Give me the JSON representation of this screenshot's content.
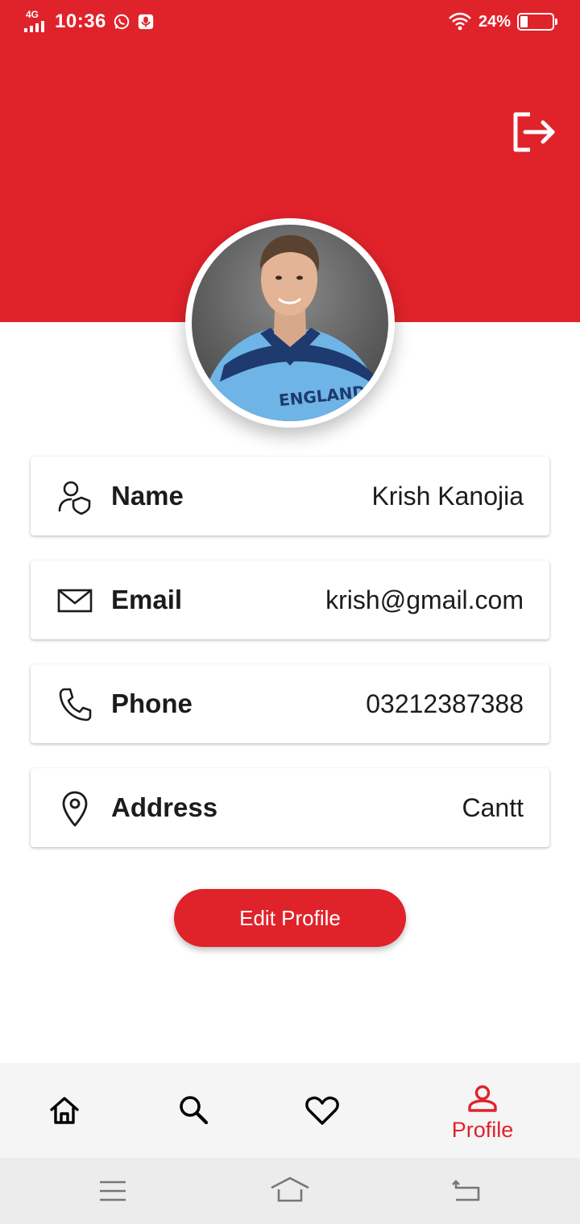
{
  "status_bar": {
    "network": "4G",
    "time": "10:36",
    "battery_percent": "24%",
    "battery_level": 0.24,
    "icons": [
      "signal-icon",
      "whatsapp-icon",
      "recorder-icon",
      "wifi-icon",
      "battery-icon"
    ]
  },
  "header": {
    "color": "#e0222b",
    "logout_icon": "logout-icon"
  },
  "profile": {
    "avatar_alt": "profile photo"
  },
  "fields": [
    {
      "icon": "user-shield-icon",
      "label": "Name",
      "value": "Krish Kanojia"
    },
    {
      "icon": "mail-icon",
      "label": "Email",
      "value": "krish@gmail.com"
    },
    {
      "icon": "phone-icon",
      "label": "Phone",
      "value": "03212387388"
    },
    {
      "icon": "location-pin-icon",
      "label": "Address",
      "value": "Cantt"
    }
  ],
  "edit_button": {
    "label": "Edit Profile"
  },
  "bottom_nav": {
    "items": [
      {
        "icon": "home-icon",
        "label": ""
      },
      {
        "icon": "search-icon",
        "label": ""
      },
      {
        "icon": "heart-icon",
        "label": ""
      },
      {
        "icon": "person-icon",
        "label": "Profile",
        "active": true
      }
    ],
    "active_color": "#e0222b"
  },
  "system_nav": {
    "icons": [
      "menu-icon",
      "home-outline-icon",
      "back-icon"
    ]
  }
}
